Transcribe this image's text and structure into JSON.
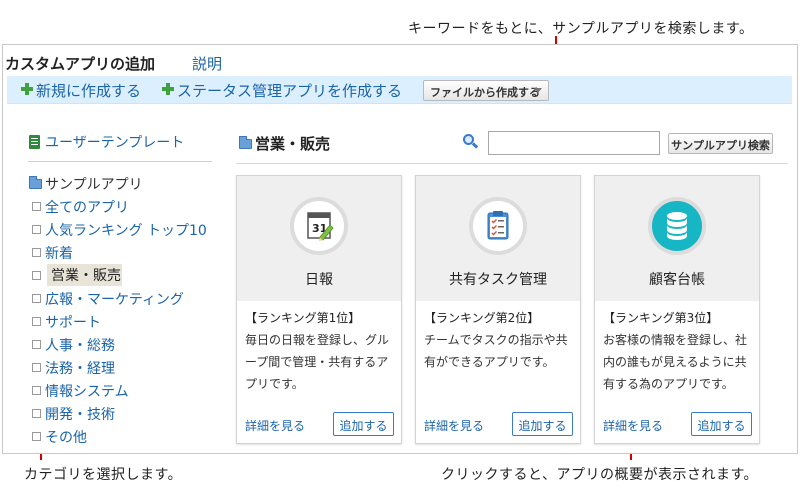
{
  "annotations": {
    "top": "キーワードをもとに、サンプルアプリを検索します。",
    "bottom_left": "カテゴリを選択します。",
    "bottom_right": "クリックすると、アプリの概要が表示されます。"
  },
  "header": {
    "title": "カスタムアプリの追加",
    "help": "説明"
  },
  "toolbar": {
    "new_label": "新規に作成する",
    "status_label": "ステータス管理アプリを作成する",
    "file_label": "ファイルから作成する"
  },
  "sidebar": {
    "template_label": "ユーザーテンプレート",
    "sample_label": "サンプルアプリ",
    "items": [
      "全てのアプリ",
      "人気ランキング トップ10",
      "新着",
      "営業・販売",
      "広報・マーケティング",
      "サポート",
      "人事・総務",
      "法務・経理",
      "情報システム",
      "開発・技術",
      "その他"
    ]
  },
  "main": {
    "category_title": "営業・販売",
    "search_placeholder": "",
    "search_button": "サンプルアプリ検索",
    "cards": [
      {
        "name": "日報",
        "rank": "【ランキング第1位】",
        "desc": "毎日の日報を登録し、グループ間で管理・共有するアプリです。",
        "detail": "詳細を見る",
        "add": "追加する",
        "icon": "calendar-icon"
      },
      {
        "name": "共有タスク管理",
        "rank": "【ランキング第2位】",
        "desc": "チームでタスクの指示や共有ができるアプリです。",
        "detail": "詳細を見る",
        "add": "追加する",
        "icon": "checklist-icon"
      },
      {
        "name": "顧客台帳",
        "rank": "【ランキング第3位】",
        "desc": "お客様の情報を登録し、社内の誰もが見えるように共有する為のアプリです。",
        "detail": "詳細を見る",
        "add": "追加する",
        "icon": "database-icon"
      }
    ]
  },
  "colors": {
    "accent_link": "#1a64a8",
    "annotation_red": "#d40000",
    "toolbar_bg": "#dcefff",
    "database_teal": "#17b6c4"
  }
}
